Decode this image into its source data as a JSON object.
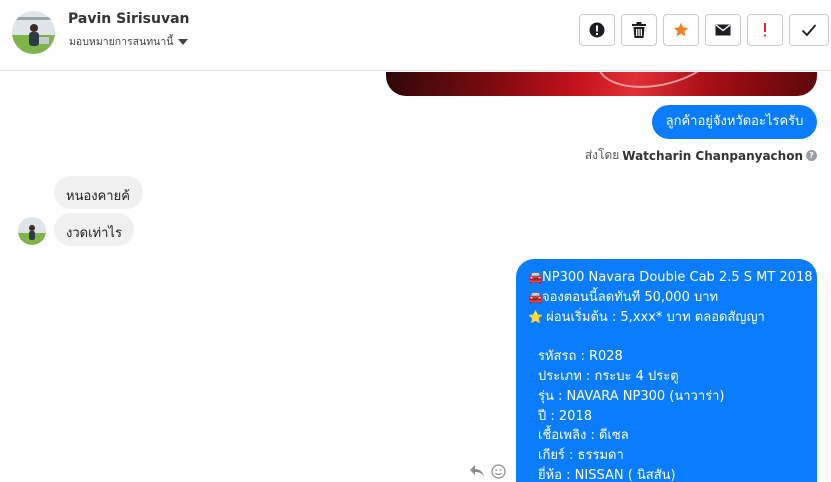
{
  "header": {
    "contact_name": "Pavin Sirisuvan",
    "assign_label": "มอบหมายการสนทนานี้",
    "actions": [
      {
        "name": "report-spam",
        "icon": "exclamation-circle-icon"
      },
      {
        "name": "delete",
        "icon": "trash-icon"
      },
      {
        "name": "star",
        "icon": "star-icon",
        "color": "#f5822a"
      },
      {
        "name": "mark-unread",
        "icon": "envelope-icon"
      },
      {
        "name": "follow-up",
        "icon": "exclamation-icon",
        "color": "#e4212c"
      },
      {
        "name": "mark-done",
        "icon": "check-icon"
      }
    ]
  },
  "thread": {
    "msg_outgoing_1": "ลูกค้าอยู่จังหวัดอะไรครับ",
    "sent_by_prefix": "ส่งโดย",
    "sent_by_name": "Watcharin Chanpanyachon",
    "msg_incoming_1": "หนองคายค้",
    "msg_incoming_2": "งวดเท่าไร",
    "car_lines": [
      {
        "icon": "car-icon",
        "text": "NP300 Navara Double Cab 2.5 S MT 2018"
      },
      {
        "icon": "car-icon",
        "text": "จองตอนนี้ลดทันที 50,000 บาท"
      },
      {
        "icon": "star-icon",
        "text": " ผ่อนเริ่มต้น : 5,xxx* บาท ตลอดสัญญา"
      }
    ],
    "car_details": [
      "รหัสรถ : R028",
      "ประเภท : กระบะ 4 ประตู",
      "รุ่น : NAVARA NP300 (นาวาร่า)",
      "ปี : 2018",
      "เชื้อเพลิง : ดีเซล",
      "เกียร์ : ธรรมดา",
      "ยี่ห้อ : NISSAN ( นิสสัน)"
    ]
  },
  "colors": {
    "accent": "#0a7cff",
    "incoming_bg": "#f0f0f0"
  }
}
